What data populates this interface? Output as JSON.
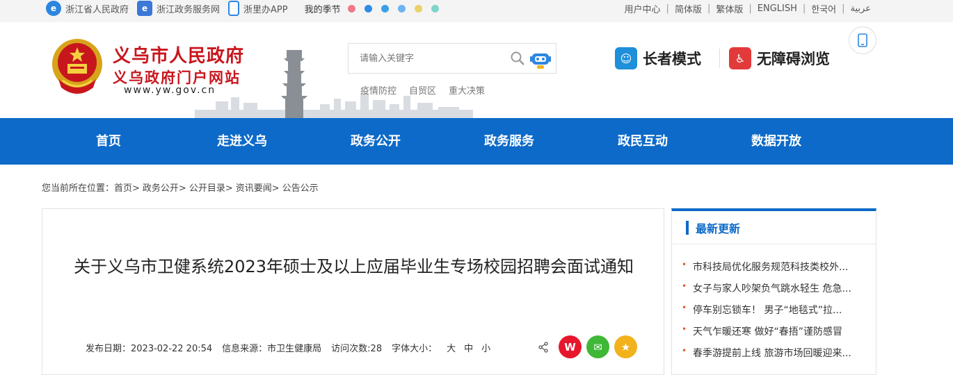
{
  "topbar": {
    "links": [
      {
        "label": "浙江省人民政府",
        "icon": "zj-gov-icon"
      },
      {
        "label": "浙江政务服务网",
        "icon": "zj-service-icon"
      },
      {
        "label": "浙里办APP",
        "icon": "phone-app-icon"
      }
    ],
    "season_label": "我的季节",
    "season_colors": [
      "#f07a8a",
      "#2e8be6",
      "#3aa0e8",
      "#6db4ef",
      "#e9d26a",
      "#7fd4c9"
    ],
    "right_links": [
      "用户中心",
      "简体版",
      "繁体版",
      "ENGLISH",
      "한국어",
      "عربية"
    ]
  },
  "header": {
    "title": "义乌市人民政府",
    "subtitle": "义乌政府门户网站",
    "url": "www.yw.gov.cn",
    "search_placeholder": "请输入关键字",
    "hotwords": [
      "疫情防控",
      "自贸区",
      "重大决策"
    ],
    "elder_mode": "长者模式",
    "accessible": "无障碍浏览"
  },
  "nav": {
    "items": [
      "首页",
      "走进义乌",
      "政务公开",
      "政务服务",
      "政民互动",
      "数据开放"
    ]
  },
  "breadcrumb": {
    "prefix": "您当前所在位置：",
    "items": [
      "首页>",
      "政务公开>",
      "公开目录>",
      "资讯要闻>",
      "公告公示"
    ]
  },
  "article": {
    "title": "关于义乌市卫健系统2023年硕士及以上应届毕业生专场校园招聘会面试通知",
    "publish_date": "发布日期：2023-02-22 20:54",
    "source": "信息来源：市卫生健康局",
    "visits": "访问次数:28",
    "font_label": "字体大小：",
    "font_sizes": [
      "大",
      "中",
      "小"
    ]
  },
  "sidebar": {
    "heading": "最新更新",
    "items": [
      "市科技局优化服务规范科技类校外...",
      "女子与家人吵架负气跳水轻生 危急...",
      "停车别忘锁车！ 男子“地毯式”拉...",
      "天气乍暖还寒 做好“春捂”谨防感冒",
      "春季游提前上线 旅游市场回暖迎来..."
    ]
  },
  "colors": {
    "nav_blue": "#0d6ac8",
    "brand_red": "#c8161d",
    "weibo_red": "#e6162d",
    "wechat_green": "#3fb836",
    "favorite_yellow": "#f2b21c"
  }
}
